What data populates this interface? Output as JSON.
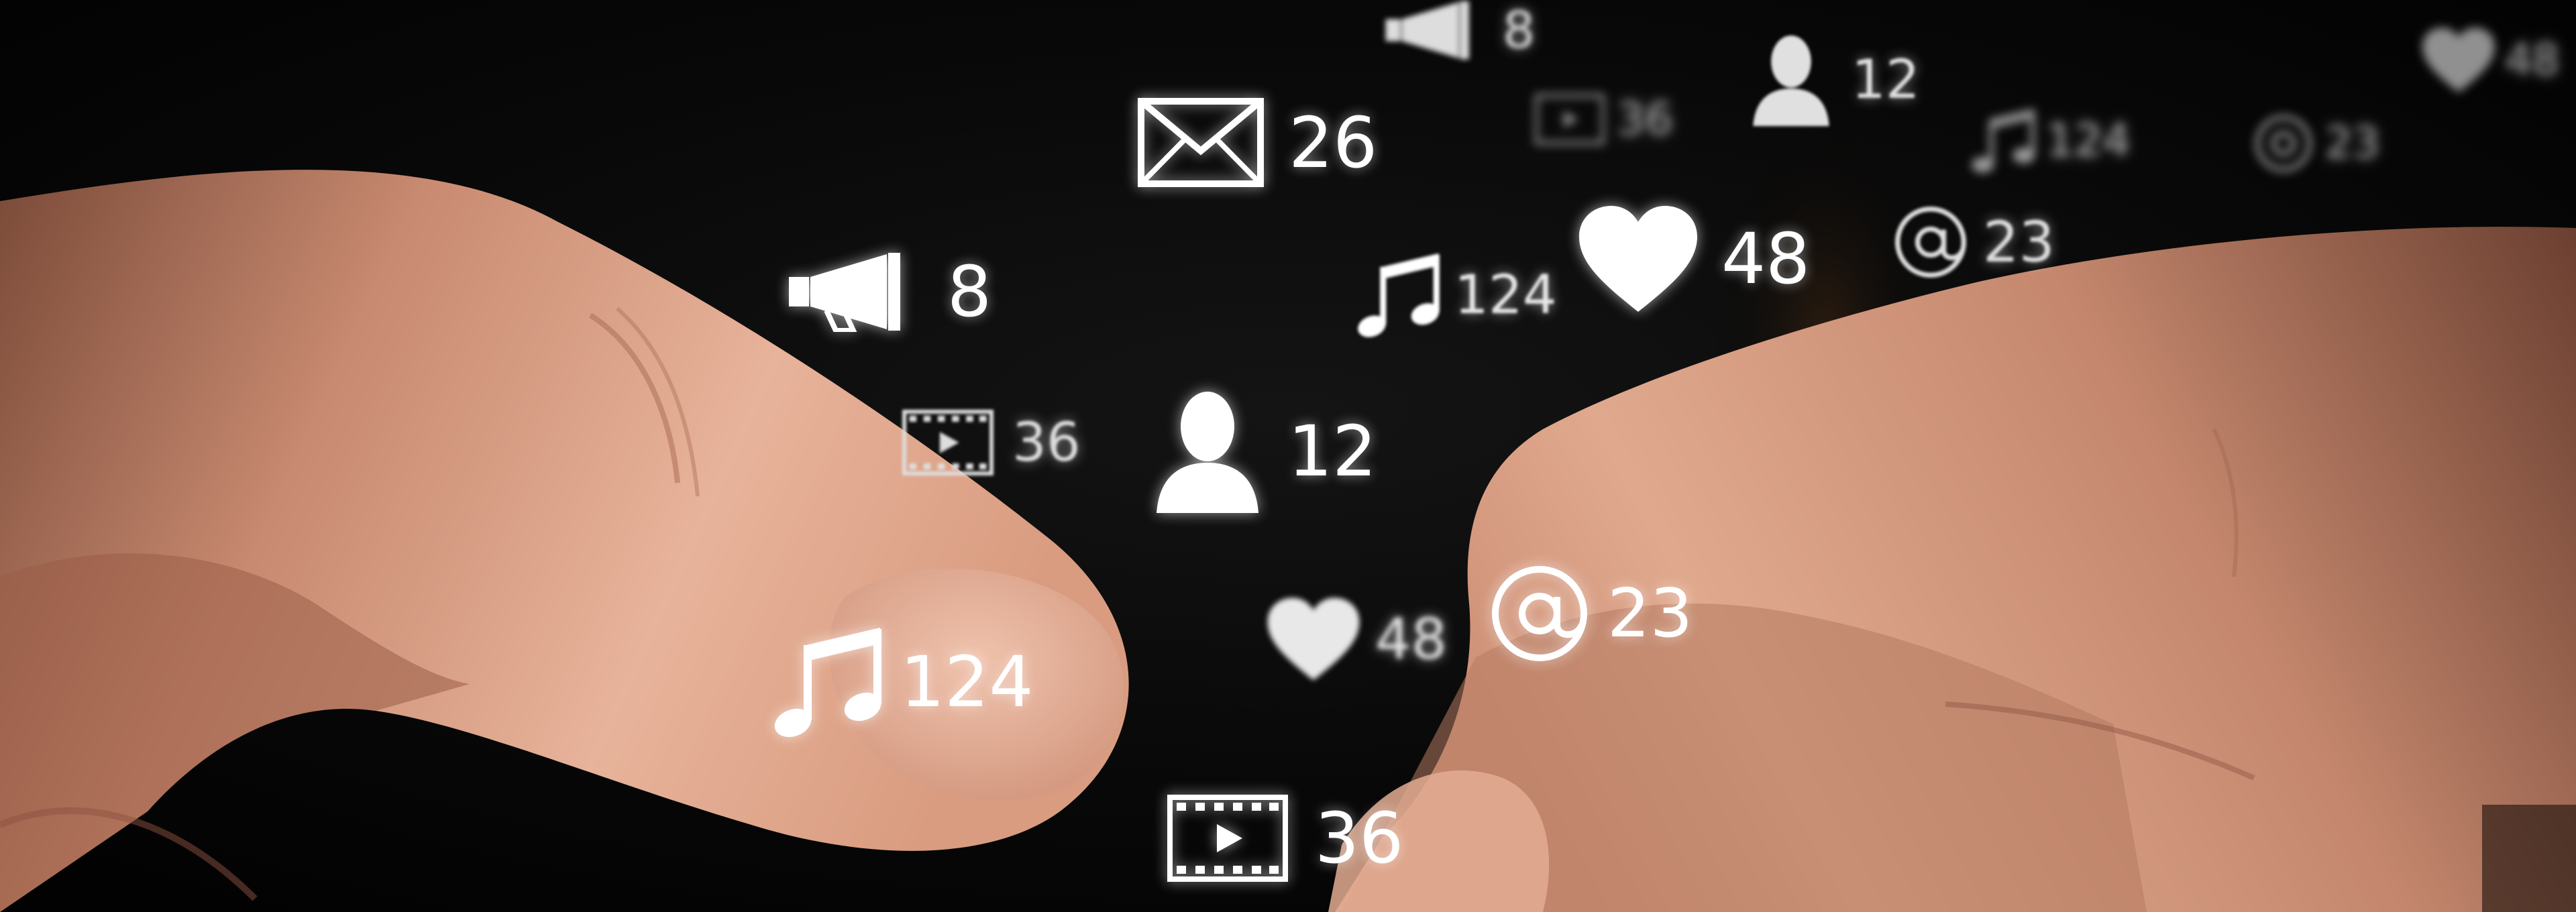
{
  "scene": {
    "description_kind": "photo",
    "background_color": "#050505",
    "skin_tone": "#d9a184",
    "icon_color": "#ffffff"
  },
  "badges": [
    {
      "icon": "envelope-icon",
      "value": "26"
    },
    {
      "icon": "megaphone-icon",
      "value": "8"
    },
    {
      "icon": "user-icon",
      "value": "12"
    },
    {
      "icon": "heart-icon",
      "value": "48"
    },
    {
      "icon": "music-note-icon",
      "value": "124"
    },
    {
      "icon": "music-note-icon",
      "value": "124"
    },
    {
      "icon": "film-icon",
      "value": "36"
    },
    {
      "icon": "film-icon",
      "value": "36"
    },
    {
      "icon": "at-sign-icon",
      "value": "23"
    },
    {
      "icon": "at-sign-icon",
      "value": "23"
    },
    {
      "icon": "heart-icon",
      "value": "48"
    },
    {
      "icon": "megaphone-icon",
      "value": "8"
    },
    {
      "icon": "user-icon",
      "value": "12"
    },
    {
      "icon": "film-icon",
      "value": "36"
    },
    {
      "icon": "music-note-icon",
      "value": "124"
    },
    {
      "icon": "at-sign-icon",
      "value": "23"
    },
    {
      "icon": "heart-icon",
      "value": "48"
    }
  ]
}
